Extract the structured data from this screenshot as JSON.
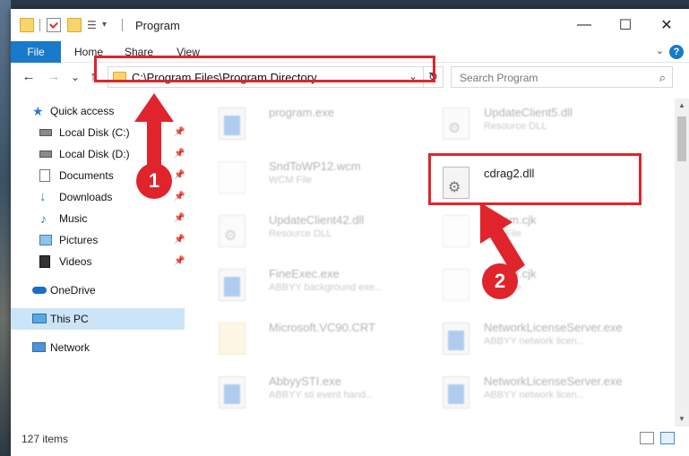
{
  "window": {
    "title": "Program",
    "minimize_glyph": "—",
    "maximize_glyph": "☐",
    "close_glyph": "✕"
  },
  "ribbon": {
    "tabs": [
      "File",
      "Home",
      "Share",
      "View"
    ],
    "help": "?"
  },
  "navigation": {
    "back_glyph": "←",
    "forward_glyph": "→",
    "recent_glyph": "⌄",
    "up_glyph": "↑",
    "address": "C:\\Program Files\\Program Directory",
    "refresh_glyph": "↻",
    "search_placeholder": "Search Program",
    "search_glyph": "⌕"
  },
  "sidebar": {
    "items": [
      {
        "label": "Quick access",
        "icon": "star-icon"
      },
      {
        "label": "Local Disk (C:)",
        "icon": "disk-icon",
        "pinned": true
      },
      {
        "label": "Local Disk (D:)",
        "icon": "disk-icon",
        "pinned": true
      },
      {
        "label": "Documents",
        "icon": "documents-icon",
        "pinned": true
      },
      {
        "label": "Downloads",
        "icon": "download-icon",
        "pinned": true
      },
      {
        "label": "Music",
        "icon": "music-icon",
        "pinned": true
      },
      {
        "label": "Pictures",
        "icon": "pictures-icon",
        "pinned": true
      },
      {
        "label": "Videos",
        "icon": "videos-icon",
        "pinned": true
      },
      {
        "label": "OneDrive",
        "icon": "cloud-icon"
      },
      {
        "label": "This PC",
        "icon": "computer-icon",
        "selected": true
      },
      {
        "label": "Network",
        "icon": "network-icon"
      }
    ]
  },
  "files": {
    "left": [
      {
        "name": "program.exe",
        "type": ""
      },
      {
        "name": "SndToWP12.wcm",
        "type": "WCM File"
      },
      {
        "name": "UpdateClient42.dll",
        "type": "Resource DLL"
      },
      {
        "name": "FineExec.exe",
        "type": "ABBYY background exe..."
      },
      {
        "name": "Microsoft.VC90.CRT",
        "type": ""
      },
      {
        "name": "AbbyySTI.exe",
        "type": "ABBYY sti event hand..."
      }
    ],
    "right": [
      {
        "name": "UpdateClient5.dll",
        "type": "Resource DLL"
      },
      {
        "name": "cdrag2.dll",
        "type": ""
      },
      {
        "name": "FrKom.cjk",
        "type": "CJK File"
      },
      {
        "name": "FrKom.cjk",
        "type": "CJK File"
      },
      {
        "name": "NetworkLicenseServer.exe",
        "type": "ABBYY network licen..."
      },
      {
        "name": "NetworkLicenseServer.exe",
        "type": "ABBYY network licen..."
      }
    ]
  },
  "status": {
    "item_count": "127 items"
  },
  "annotations": {
    "step1": "1",
    "step2": "2",
    "color": "#e0242c"
  }
}
